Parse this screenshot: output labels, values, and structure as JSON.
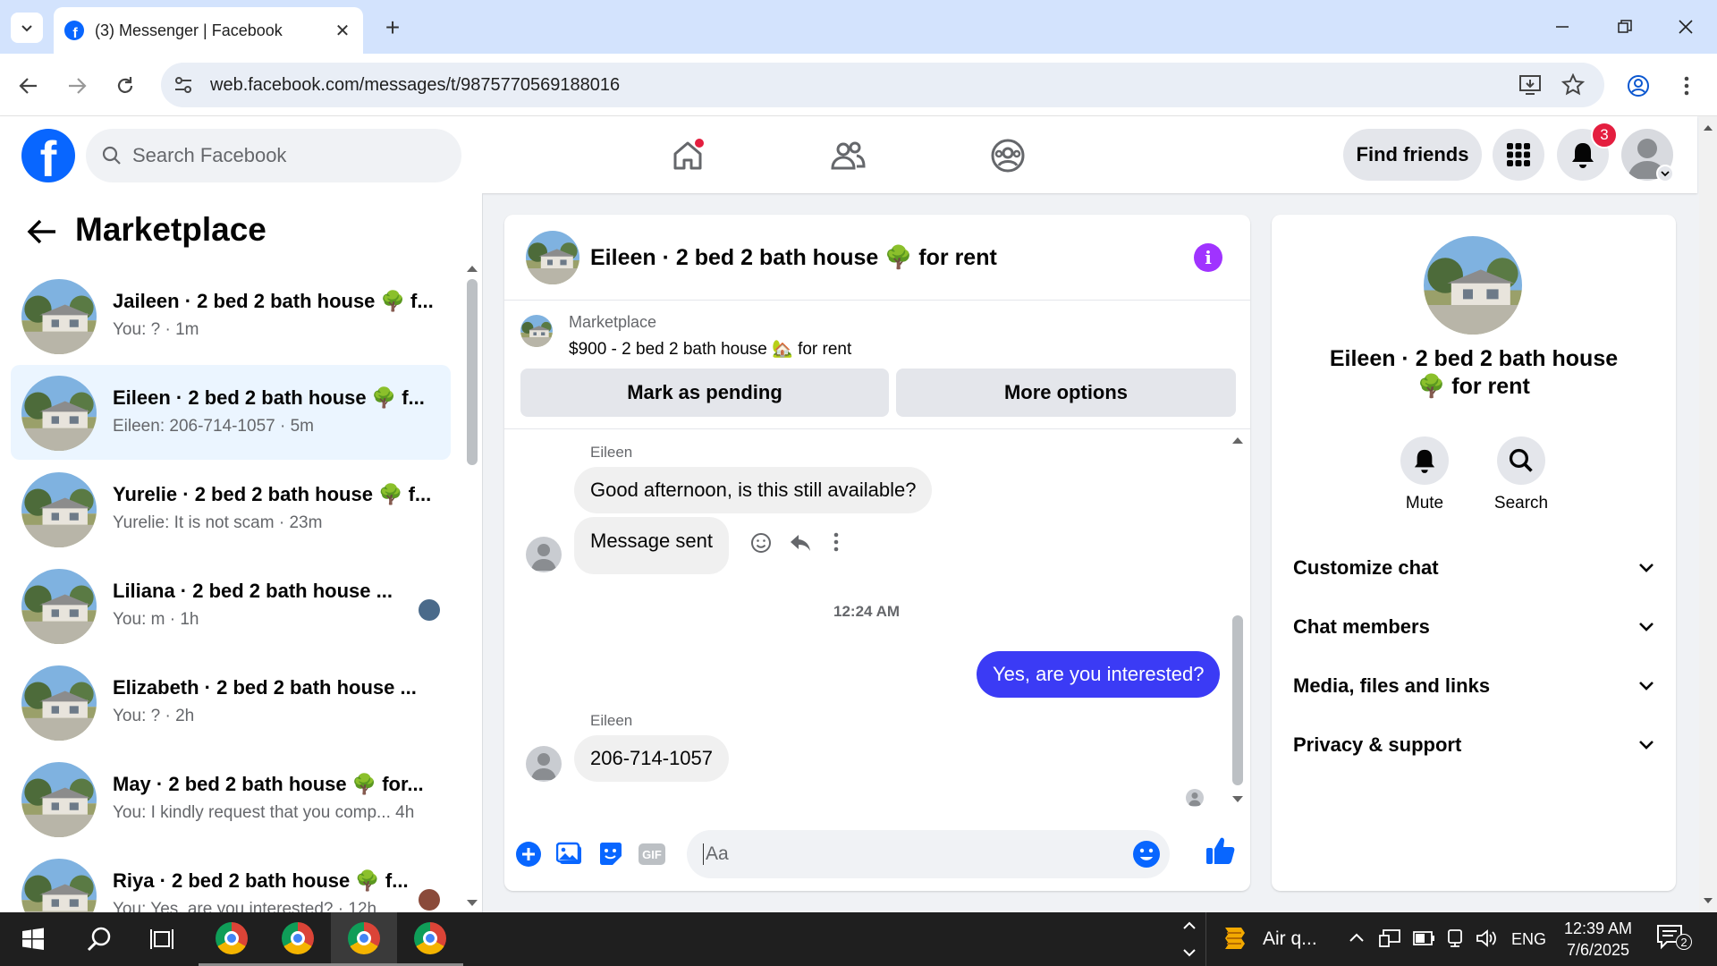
{
  "browser": {
    "tab_title": "(3) Messenger | Facebook",
    "url": "web.facebook.com/messages/t/9875770569188016"
  },
  "header": {
    "search_placeholder": "Search Facebook",
    "find_friends": "Find friends",
    "notification_count": "3"
  },
  "sidebar": {
    "title": "Marketplace",
    "conversations": [
      {
        "name": "Jaileen · 2 bed 2 bath house 🌳 f...",
        "sub": "You: ? · 1m",
        "active": false
      },
      {
        "name": "Eileen · 2 bed 2 bath house 🌳 f...",
        "sub": "Eileen: 206-714-1057 · 5m",
        "active": true
      },
      {
        "name": "Yurelie · 2 bed 2 bath house 🌳 f...",
        "sub": "Yurelie: It is not scam · 23m",
        "active": false
      },
      {
        "name": "Liliana · 2 bed 2 bath house ...",
        "sub": "You: m · 1h",
        "active": false
      },
      {
        "name": "Elizabeth · 2 bed 2 bath house ...",
        "sub": "You: ? · 2h",
        "active": false
      },
      {
        "name": "May · 2 bed 2 bath house 🌳 for...",
        "sub": "You: I kindly request that you comp...  4h",
        "active": false
      },
      {
        "name": "Riya · 2 bed 2 bath house 🌳 f...",
        "sub": "You: Yes, are you interested? · 12h",
        "active": false
      }
    ]
  },
  "chat": {
    "title": "Eileen · 2 bed 2 bath house 🌳 for rent",
    "listing_label": "Marketplace",
    "listing_price": "$900 - 2 bed 2 bath house 🏡 for rent",
    "mark_pending": "Mark as pending",
    "more_options": "More options",
    "messages": {
      "sender1": "Eileen",
      "msg1": "Good afternoon, is this still available?",
      "msg2": "Message sent",
      "timestamp": "12:24 AM",
      "msg3": "Yes, are you interested?",
      "sender2": "Eileen",
      "msg4": "206-714-1057"
    },
    "composer_placeholder": "Aa"
  },
  "rightpanel": {
    "name": "Eileen · 2 bed 2 bath house 🌳 for rent",
    "mute": "Mute",
    "search": "Search",
    "rows": [
      "Customize chat",
      "Chat members",
      "Media, files and links",
      "Privacy & support"
    ]
  },
  "taskbar": {
    "weather": "Air q...",
    "lang": "ENG",
    "time": "12:39 AM",
    "date": "7/6/2025",
    "notif": "2"
  }
}
